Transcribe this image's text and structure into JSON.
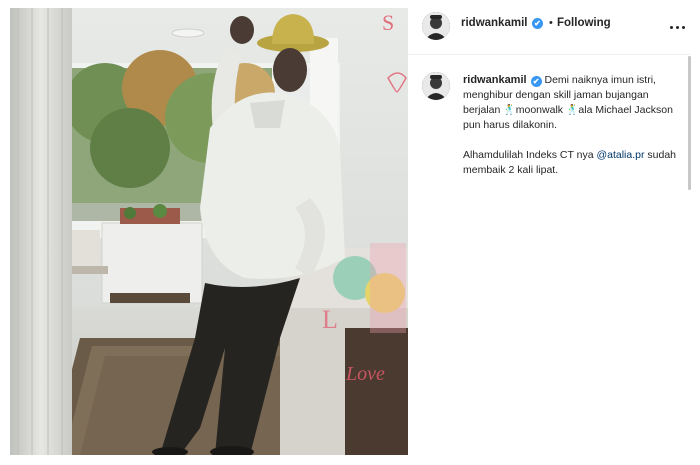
{
  "post": {
    "username": "ridwankamil",
    "follow_status": "Following",
    "separator": "•",
    "verified_mark": "✔",
    "more_icon": "more-horizontal-icon"
  },
  "caption": {
    "username": "ridwankamil",
    "line1": "Demi naiknya imun istri, menghibur dengan skill jaman bujangan berjalan",
    "emoji": "🕺",
    "moonwalk": "moonwalk",
    "line2": "ala Michael Jackson pun harus dilakonin.",
    "para2_prefix": "Alhamdulilah Indeks CT nya",
    "mention": "@atalia.pr",
    "para2_suffix": "sudah membaik 2 kali lipat."
  },
  "media": {
    "overlay_letters": [
      "S",
      "L",
      "Love"
    ]
  },
  "colors": {
    "verified": "#3897f0",
    "mention": "#00376b",
    "text": "#262626"
  }
}
